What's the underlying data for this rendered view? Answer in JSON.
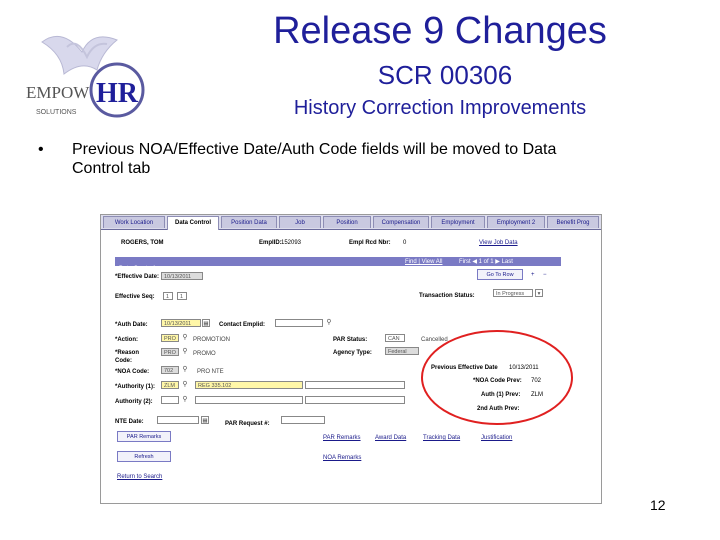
{
  "slide": {
    "title": "Release 9 Changes",
    "subtitle": "SCR 00306",
    "subsubtitle": "History Correction Improvements",
    "bullet_symbol": "•",
    "bullet": "Previous NOA/Effective Date/Auth Code fields will be moved to Data Control tab",
    "page_number": "12",
    "logo": {
      "text_left": "EMPOW",
      "text_right": "HR",
      "tagline": "SOLUTIONS"
    }
  },
  "screen": {
    "tabs": [
      {
        "label": "Work Location"
      },
      {
        "label": "Data Control",
        "active": true
      },
      {
        "label": "Position Data"
      },
      {
        "label": "Job"
      },
      {
        "label": "Position"
      },
      {
        "label": "Compensation"
      },
      {
        "label": "Employment"
      },
      {
        "label": "Employment 2"
      },
      {
        "label": "Benefit Prog"
      }
    ],
    "header": {
      "name": "ROGERS, TOM",
      "empl_id_label": "EmplID:",
      "empl_id": "152093",
      "empl_rcd_label": "Empl Rcd Nbr:",
      "empl_rcd": "0",
      "view_link": "View Job Data"
    },
    "section": {
      "label": "Data Control",
      "nav": "First ◀ 1 of 1 ▶ Last",
      "find_link": "Find | View All",
      "goto": "Go To Row"
    },
    "fields": {
      "effective_label": "*Effective Date:",
      "effective_value": "10/13/2011",
      "eff_seq_label": "Effective Seq:",
      "eff_seq_value1": "1",
      "eff_seq_value2": "1",
      "txn_status_label": "Transaction Status:",
      "txn_status_value": "In Progress",
      "auth_date_label": "*Auth Date:",
      "auth_date_value": "10/13/2011",
      "contact_label": "Contact Emplid:",
      "action_label": "*Action:",
      "action_value": "PRO",
      "action_desc": "PROMOTION",
      "par_status_label": "PAR Status:",
      "par_status_value": "CAN",
      "par_status_desc": "Cancelled",
      "agency_label": "Agency Type:",
      "agency_value": "Federal",
      "reason_label": "*Reason Code:",
      "reason_value": "PRO",
      "reason_desc": "PROMO",
      "noa_label": "*NOA Code:",
      "noa_value": "702",
      "noa_desc": "PRO NTE",
      "authority1_label": "*Authority (1):",
      "authority1_value": "ZLM",
      "authority1_desc": "REG 335.102",
      "authority2_label": "Authority (2):",
      "prev_eff_label": "Previous Effective Date",
      "prev_eff_value": "10/13/2011",
      "prev_noa_label": "*NOA Code Prev:",
      "prev_noa_value": "702",
      "auth1_prev_label": "Auth (1) Prev:",
      "auth1_prev_value": "ZLM",
      "auth2_prev_label": "2nd Auth Prev:",
      "nte_label": "NTE Date:",
      "par_request_label": "PAR Request #:",
      "btn_remarks": "PAR Remarks",
      "btn_refresh": "Refresh",
      "links": [
        "PAR Remarks",
        "Award Data",
        "Tracking Data",
        "Justification"
      ],
      "link_noa": "NOA Remarks",
      "footer_link": "Return to Search"
    }
  }
}
